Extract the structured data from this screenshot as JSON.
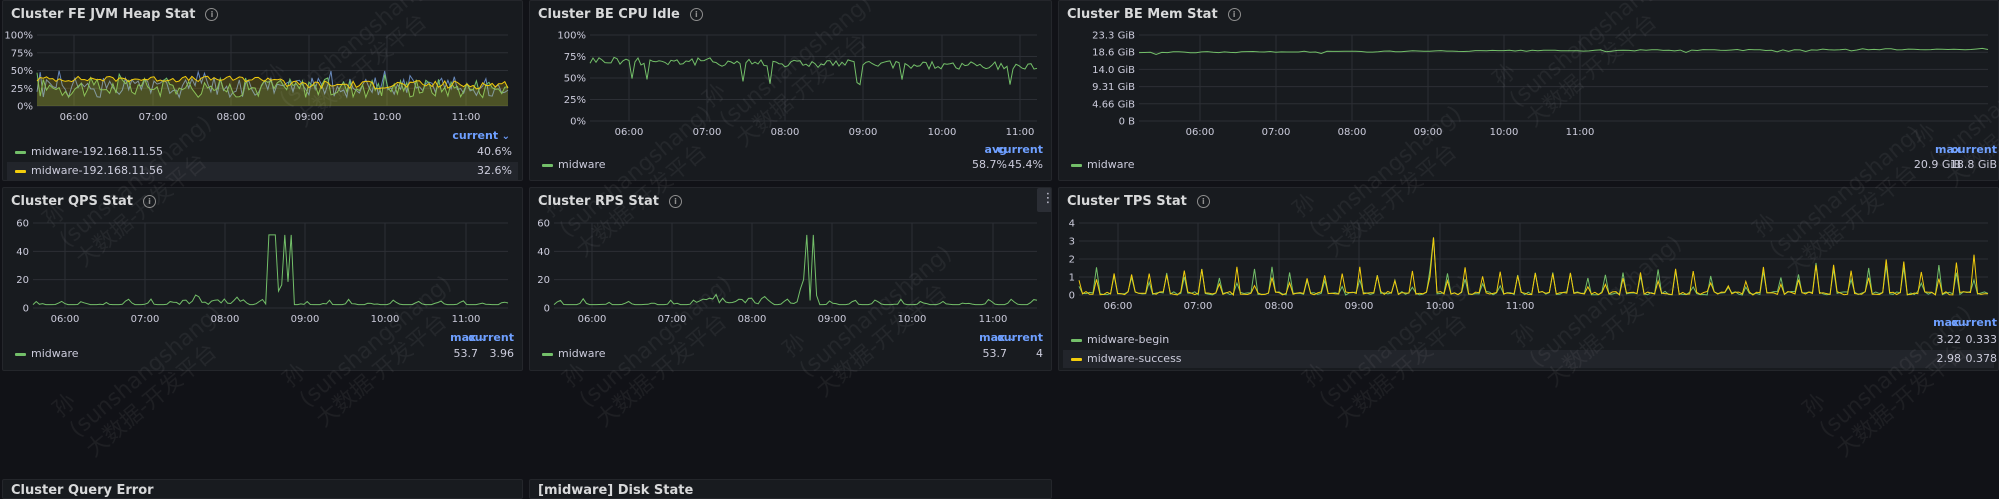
{
  "panels": [
    {
      "id": "fe-heap",
      "title": "Cluster FE JVM Heap Stat",
      "y_ticks": [
        "100%",
        "75%",
        "50%",
        "25%",
        "0%"
      ],
      "x_ticks": [
        "06:00",
        "07:00",
        "08:00",
        "09:00",
        "10:00",
        "11:00"
      ],
      "legend_columns": [
        "current"
      ],
      "legend_sort": "current",
      "series": [
        {
          "name": "midware-192.168.11.55",
          "color": "#73bf69",
          "values": [
            "40.6%"
          ]
        },
        {
          "name": "midware-192.168.11.56",
          "color": "#f2cc0c",
          "values": [
            "32.6%"
          ]
        }
      ]
    },
    {
      "id": "be-cpu",
      "title": "Cluster BE CPU Idle",
      "y_ticks": [
        "100%",
        "75%",
        "50%",
        "25%",
        "0%"
      ],
      "x_ticks": [
        "06:00",
        "07:00",
        "08:00",
        "09:00",
        "10:00",
        "11:00"
      ],
      "legend_columns": [
        "avg",
        "current"
      ],
      "series": [
        {
          "name": "midware",
          "color": "#73bf69",
          "values": [
            "58.7%",
            "45.4%"
          ]
        }
      ]
    },
    {
      "id": "be-mem",
      "title": "Cluster BE Mem Stat",
      "y_ticks": [
        "23.3 GiB",
        "18.6 GiB",
        "14.0 GiB",
        "9.31 GiB",
        "4.66 GiB",
        "0 B"
      ],
      "x_ticks": [
        "06:00",
        "07:00",
        "08:00",
        "09:00",
        "10:00",
        "11:00"
      ],
      "legend_columns": [
        "max",
        "current"
      ],
      "series": [
        {
          "name": "midware",
          "color": "#73bf69",
          "values": [
            "20.9 GiB",
            "18.8 GiB"
          ]
        }
      ]
    },
    {
      "id": "qps",
      "title": "Cluster QPS Stat",
      "y_ticks": [
        "60",
        "40",
        "20",
        "0"
      ],
      "x_ticks": [
        "06:00",
        "07:00",
        "08:00",
        "09:00",
        "10:00",
        "11:00"
      ],
      "legend_columns": [
        "max",
        "current"
      ],
      "legend_sort": "max",
      "series": [
        {
          "name": "midware",
          "color": "#73bf69",
          "values": [
            "53.7",
            "3.96"
          ]
        }
      ]
    },
    {
      "id": "rps",
      "title": "Cluster RPS Stat",
      "y_ticks": [
        "60",
        "40",
        "20",
        "0"
      ],
      "x_ticks": [
        "06:00",
        "07:00",
        "08:00",
        "09:00",
        "10:00",
        "11:00"
      ],
      "legend_columns": [
        "max",
        "current"
      ],
      "legend_sort": "max",
      "series": [
        {
          "name": "midware",
          "color": "#73bf69",
          "values": [
            "53.7",
            "4"
          ]
        }
      ]
    },
    {
      "id": "tps",
      "title": "Cluster TPS Stat",
      "y_ticks": [
        "4",
        "3",
        "2",
        "1",
        "0"
      ],
      "x_ticks": [
        "06:00",
        "07:00",
        "08:00",
        "09:00",
        "10:00",
        "11:00"
      ],
      "legend_columns": [
        "max",
        "current"
      ],
      "legend_sort": "max",
      "series": [
        {
          "name": "midware-begin",
          "color": "#73bf69",
          "values": [
            "3.22",
            "0.333"
          ]
        },
        {
          "name": "midware-success",
          "color": "#f2cc0c",
          "values": [
            "2.98",
            "0.378"
          ]
        }
      ]
    }
  ],
  "bottom_titles": [
    "Cluster Query Error",
    "[midware] Disk State"
  ],
  "watermark": "孙(sunshangshang) 大数据-开发平台",
  "icons": {
    "info": "info-circle-icon",
    "menu": "kebab-menu-icon",
    "sort": "chevron-down-icon"
  },
  "chart_data": [
    {
      "type": "area",
      "title": "Cluster FE JVM Heap Stat",
      "ylim": [
        0,
        100
      ],
      "y_unit": "%",
      "series": [
        {
          "name": "midware-192.168.11.55",
          "current": 40.6
        },
        {
          "name": "midware-192.168.11.56",
          "current": 32.6
        }
      ]
    },
    {
      "type": "line",
      "title": "Cluster BE CPU Idle",
      "ylim": [
        0,
        100
      ],
      "y_unit": "%",
      "series": [
        {
          "name": "midware",
          "avg": 58.7,
          "current": 45.4
        }
      ]
    },
    {
      "type": "line",
      "title": "Cluster BE Mem Stat",
      "ylim": [
        0,
        23.3
      ],
      "y_unit": "GiB",
      "series": [
        {
          "name": "midware",
          "max": 20.9,
          "current": 18.8
        }
      ]
    },
    {
      "type": "line",
      "title": "Cluster QPS Stat",
      "ylim": [
        0,
        60
      ],
      "series": [
        {
          "name": "midware",
          "max": 53.7,
          "current": 3.96
        }
      ]
    },
    {
      "type": "line",
      "title": "Cluster RPS Stat",
      "ylim": [
        0,
        60
      ],
      "series": [
        {
          "name": "midware",
          "max": 53.7,
          "current": 4
        }
      ]
    },
    {
      "type": "line",
      "title": "Cluster TPS Stat",
      "ylim": [
        0,
        4
      ],
      "series": [
        {
          "name": "midware-begin",
          "max": 3.22,
          "current": 0.333
        },
        {
          "name": "midware-success",
          "max": 2.98,
          "current": 0.378
        }
      ]
    }
  ]
}
